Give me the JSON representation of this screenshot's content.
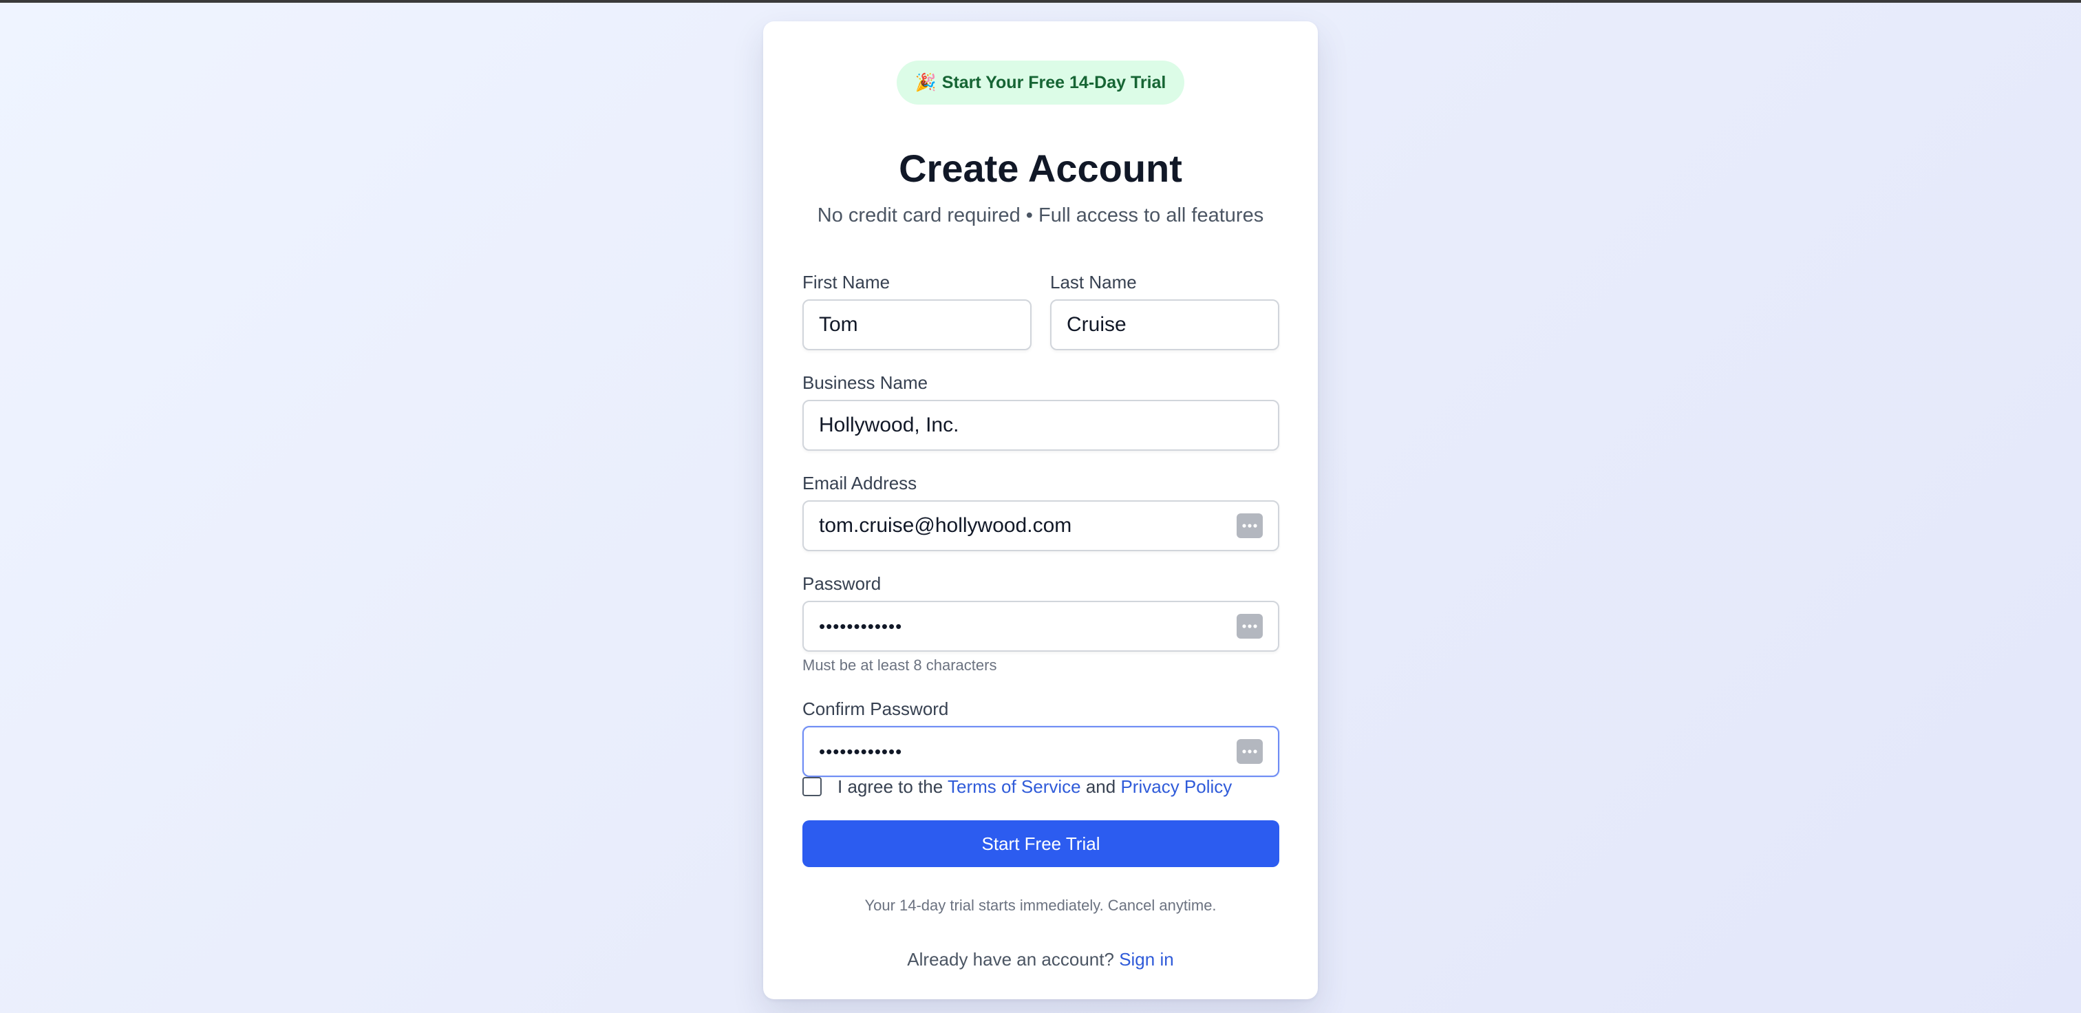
{
  "badge": {
    "icon": "party-popper-icon",
    "emoji": "🎉",
    "text": "Start Your Free 14-Day Trial"
  },
  "header": {
    "title": "Create Account",
    "subtitle": "No credit card required • Full access to all features"
  },
  "form": {
    "first_name": {
      "label": "First Name",
      "value": "Tom"
    },
    "last_name": {
      "label": "Last Name",
      "value": "Cruise"
    },
    "business_name": {
      "label": "Business Name",
      "value": "Hollywood, Inc."
    },
    "email": {
      "label": "Email Address",
      "value": "tom.cruise@hollywood.com"
    },
    "password": {
      "label": "Password",
      "value": "••••••••••••",
      "hint": "Must be at least 8 characters"
    },
    "confirm_password": {
      "label": "Confirm Password",
      "value": "••••••••••••"
    },
    "agree": {
      "prefix": "I agree to the",
      "terms_link": "Terms of Service",
      "middle": "and",
      "privacy_link": "Privacy Policy"
    },
    "submit_label": "Start Free Trial",
    "trial_note": "Your 14-day trial starts immediately. Cancel anytime."
  },
  "signin": {
    "prompt": "Already have an account?",
    "link": "Sign in"
  },
  "colors": {
    "accent": "#2c5cf0",
    "link": "#2f5bd9",
    "badge_bg": "#dcfce7",
    "badge_text": "#166534",
    "focus_border": "#6f8cf4"
  }
}
